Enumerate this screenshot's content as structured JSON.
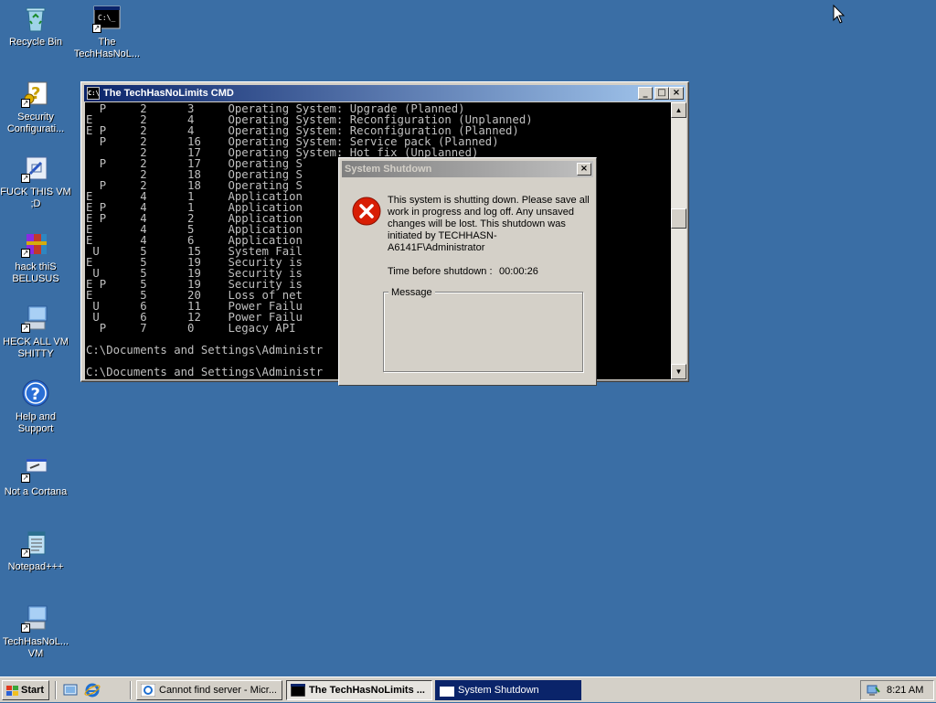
{
  "desktop": {
    "icons": [
      {
        "label": "Recycle Bin",
        "icon": "recycle-bin-icon"
      },
      {
        "label": "The TechHasNoL...",
        "icon": "console-shortcut-icon"
      },
      {
        "label": "Security Configurati...",
        "icon": "security-config-icon"
      },
      {
        "label": "FUCK THIS VM ;D",
        "icon": "shortcut-icon"
      },
      {
        "label": "hack thiS BELUSUS",
        "icon": "winrar-icon"
      },
      {
        "label": "HECK ALL VM SHITTY",
        "icon": "computer-icon"
      },
      {
        "label": "Help and Support",
        "icon": "help-icon"
      },
      {
        "label": "Not a Cortana",
        "icon": "run-icon"
      },
      {
        "label": "Notepad+++",
        "icon": "notepad-icon"
      },
      {
        "label": "TechHasNoL... VM",
        "icon": "computer-icon"
      }
    ]
  },
  "cmd_window": {
    "title": "The TechHasNoLimits CMD",
    "lines": [
      "  P     2      3     Operating System: Upgrade (Planned)",
      "E       2      4     Operating System: Reconfiguration (Unplanned)",
      "E P     2      4     Operating System: Reconfiguration (Planned)",
      "  P     2      16    Operating System: Service pack (Planned)",
      "        2      17    Operating System: Hot fix (Unplanned)",
      "  P     2      17    Operating S",
      "        2      18    Operating S",
      "  P     2      18    Operating S",
      "E       4      1     Application",
      "E P     4      1     Application",
      "E P     4      2     Application",
      "E       4      5     Application",
      "E       4      6     Application",
      " U      5      15    System Fail",
      "E       5      19    Security is",
      " U      5      19    Security is",
      "E P     5      19    Security is",
      "E       5      20    Loss of net",
      " U      6      11    Power Failu",
      " U      6      12    Power Failu",
      "  P     7      0     Legacy API",
      "",
      "C:\\Documents and Settings\\Administr",
      "",
      "C:\\Documents and Settings\\Administr"
    ]
  },
  "shutdown_dialog": {
    "title": "System Shutdown",
    "message": "This system is shutting down. Please save all work in progress and log off. Any unsaved changes will be lost. This shutdown was initiated by TECHHASN-A6141F\\Administrator",
    "time_label": "Time before shutdown :",
    "time_value": "00:00:26",
    "message_group_label": "Message"
  },
  "taskbar": {
    "start_label": "Start",
    "buttons": [
      {
        "label": "Cannot find server - Micr...",
        "icon": "ie-icon"
      },
      {
        "label": "The TechHasNoLimits ...",
        "icon": "console-icon"
      },
      {
        "label": "System Shutdown",
        "icon": "window-icon"
      }
    ],
    "clock": "8:21 AM"
  },
  "colors": {
    "desktop": "#3a6ea5",
    "active_title": "#0a246a",
    "inactive_title": "#808080",
    "error_red": "#d81e05"
  }
}
